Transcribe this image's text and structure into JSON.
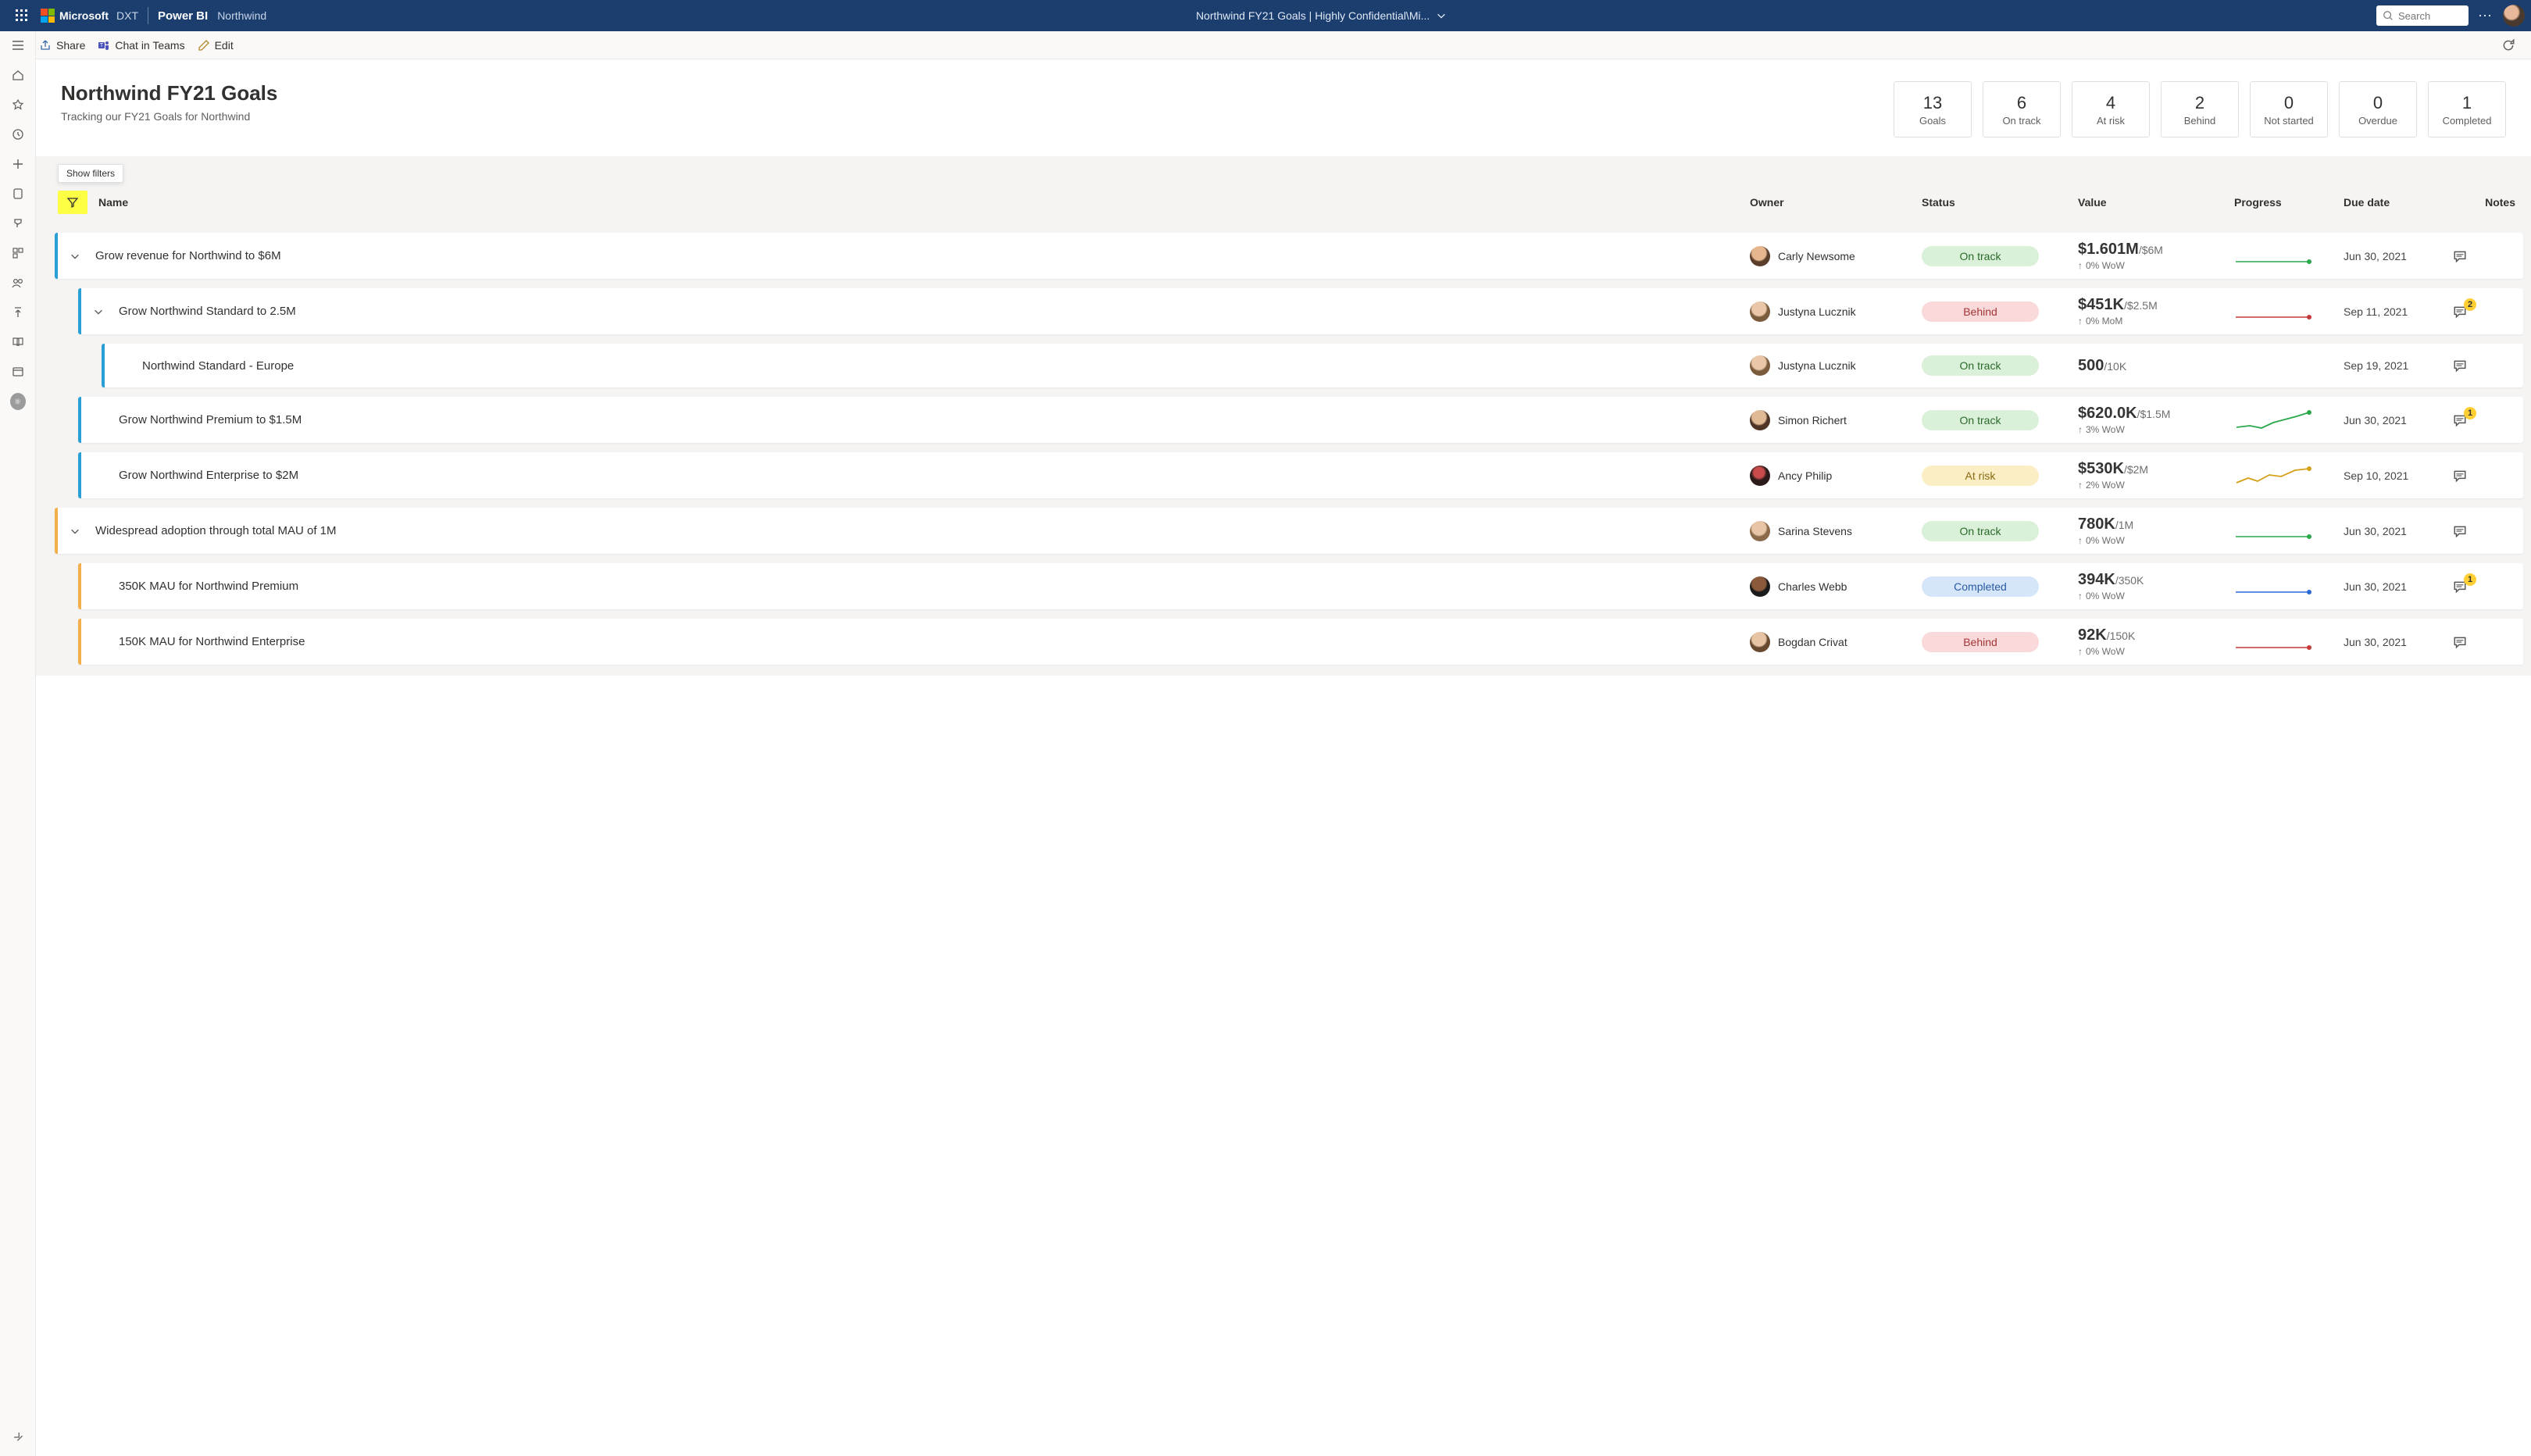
{
  "topbar": {
    "brand": "Microsoft",
    "dxt": "DXT",
    "product": "Power BI",
    "workspace": "Northwind",
    "center": "Northwind FY21 Goals  |  Highly Confidential\\Mi...",
    "search_placeholder": "Search"
  },
  "cmdbar": {
    "share": "Share",
    "chat": "Chat in Teams",
    "edit": "Edit"
  },
  "header": {
    "title": "Northwind FY21 Goals",
    "subtitle": "Tracking our FY21 Goals for Northwind"
  },
  "kpis": [
    {
      "num": "13",
      "label": "Goals"
    },
    {
      "num": "6",
      "label": "On track"
    },
    {
      "num": "4",
      "label": "At risk"
    },
    {
      "num": "2",
      "label": "Behind"
    },
    {
      "num": "0",
      "label": "Not started"
    },
    {
      "num": "0",
      "label": "Overdue"
    },
    {
      "num": "1",
      "label": "Completed"
    }
  ],
  "tooltip": "Show filters",
  "cols": {
    "name": "Name",
    "owner": "Owner",
    "status": "Status",
    "value": "Value",
    "progress": "Progress",
    "due": "Due date",
    "notes": "Notes"
  },
  "rows": [
    {
      "indent": 0,
      "bar": "blue",
      "expand": true,
      "name": "Grow revenue for Northwind to $6M",
      "owner": "Carly Newsome",
      "av": "av1",
      "status": "On track",
      "stClass": "st-ontrack",
      "val": "$1.601M",
      "tgt": "/$6M",
      "delta": "0% WoW",
      "spark": "flat-green-dot",
      "due": "Jun 30, 2021",
      "badge": null
    },
    {
      "indent": 1,
      "bar": "blue",
      "expand": true,
      "name": "Grow Northwind Standard to 2.5M",
      "owner": "Justyna Lucznik",
      "av": "av2",
      "status": "Behind",
      "stClass": "st-behind",
      "val": "$451K",
      "tgt": "/$2.5M",
      "delta": "0% MoM",
      "spark": "flat-red-dot",
      "due": "Sep 11, 2021",
      "badge": "2"
    },
    {
      "indent": 2,
      "bar": "blue",
      "expand": false,
      "name": "Northwind Standard - Europe",
      "owner": "Justyna Lucznik",
      "av": "av2",
      "status": "On track",
      "stClass": "st-ontrack",
      "val": "500",
      "tgt": "/10K",
      "delta": "",
      "spark": "none",
      "due": "Sep 19, 2021",
      "badge": null
    },
    {
      "indent": 1,
      "bar": "blue",
      "expand": false,
      "name": "Grow Northwind Premium to $1.5M",
      "owner": "Simon Richert",
      "av": "av3",
      "status": "On track",
      "stClass": "st-ontrack",
      "val": "$620.0K",
      "tgt": "/$1.5M",
      "delta": "3% WoW",
      "spark": "up-green",
      "due": "Jun 30, 2021",
      "badge": "1"
    },
    {
      "indent": 1,
      "bar": "blue",
      "expand": false,
      "name": "Grow Northwind Enterprise to $2M",
      "owner": "Ancy Philip",
      "av": "av4",
      "status": "At risk",
      "stClass": "st-atrisk",
      "val": "$530K",
      "tgt": "/$2M",
      "delta": "2% WoW",
      "spark": "up-amber",
      "due": "Sep 10, 2021",
      "badge": null
    },
    {
      "indent": 0,
      "bar": "orange",
      "expand": true,
      "name": "Widespread adoption through total MAU of 1M",
      "owner": "Sarina Stevens",
      "av": "av5",
      "status": "On track",
      "stClass": "st-ontrack",
      "val": "780K",
      "tgt": "/1M",
      "delta": "0% WoW",
      "spark": "flat-green-dot",
      "due": "Jun 30, 2021",
      "badge": null
    },
    {
      "indent": 1,
      "bar": "orange",
      "expand": false,
      "name": "350K MAU for Northwind Premium",
      "owner": "Charles Webb",
      "av": "av6",
      "status": "Completed",
      "stClass": "st-completed",
      "val": "394K",
      "tgt": "/350K",
      "delta": "0% WoW",
      "spark": "flat-blue-dot",
      "due": "Jun 30, 2021",
      "badge": "1"
    },
    {
      "indent": 1,
      "bar": "orange",
      "expand": false,
      "name": "150K MAU for Northwind Enterprise",
      "owner": "Bogdan Crivat",
      "av": "av7",
      "status": "Behind",
      "stClass": "st-behind",
      "val": "92K",
      "tgt": "/150K",
      "delta": "0% WoW",
      "spark": "flat-red-dot",
      "due": "Jun 30, 2021",
      "badge": null
    }
  ]
}
